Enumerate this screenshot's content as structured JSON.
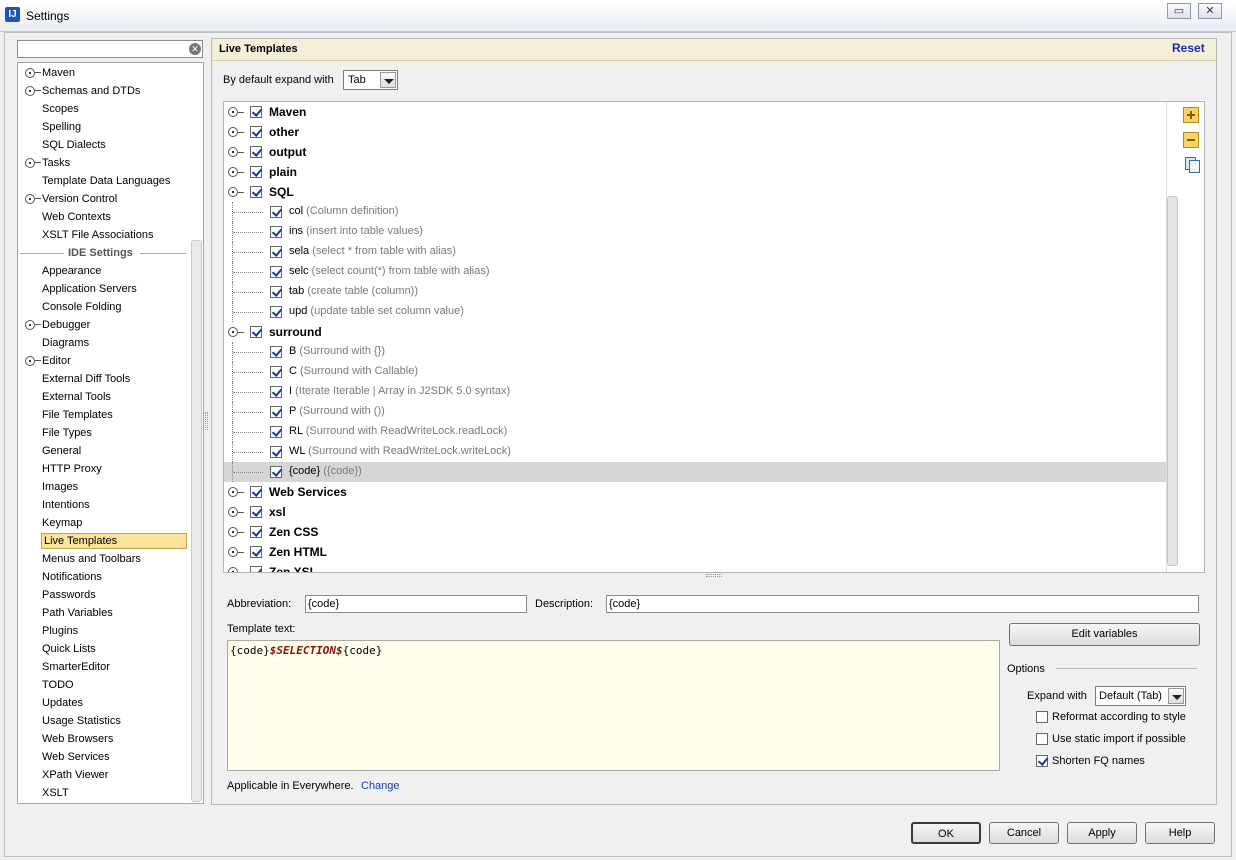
{
  "window": {
    "title": "Settings",
    "app_icon": "intellij-icon"
  },
  "search": {
    "value": ""
  },
  "sidebar": {
    "items_before": [
      {
        "label": "Maven",
        "expandable": true
      },
      {
        "label": "Schemas and DTDs",
        "expandable": true
      },
      {
        "label": "Scopes",
        "expandable": false
      },
      {
        "label": "Spelling",
        "expandable": false
      },
      {
        "label": "SQL Dialects",
        "expandable": false
      },
      {
        "label": "Tasks",
        "expandable": true
      },
      {
        "label": "Template Data Languages",
        "expandable": false
      },
      {
        "label": "Version Control",
        "expandable": true
      },
      {
        "label": "Web Contexts",
        "expandable": false
      },
      {
        "label": "XSLT File Associations",
        "expandable": false
      }
    ],
    "ide_header": "IDE Settings",
    "items_after": [
      {
        "label": "Appearance",
        "expandable": false
      },
      {
        "label": "Application Servers",
        "expandable": false
      },
      {
        "label": "Console Folding",
        "expandable": false
      },
      {
        "label": "Debugger",
        "expandable": true
      },
      {
        "label": "Diagrams",
        "expandable": false
      },
      {
        "label": "Editor",
        "expandable": true
      },
      {
        "label": "External Diff Tools",
        "expandable": false
      },
      {
        "label": "External Tools",
        "expandable": false
      },
      {
        "label": "File Templates",
        "expandable": false
      },
      {
        "label": "File Types",
        "expandable": false
      },
      {
        "label": "General",
        "expandable": false
      },
      {
        "label": "HTTP Proxy",
        "expandable": false
      },
      {
        "label": "Images",
        "expandable": false
      },
      {
        "label": "Intentions",
        "expandable": false
      },
      {
        "label": "Keymap",
        "expandable": false
      },
      {
        "label": "Live Templates",
        "expandable": false,
        "selected": true
      },
      {
        "label": "Menus and Toolbars",
        "expandable": false
      },
      {
        "label": "Notifications",
        "expandable": false
      },
      {
        "label": "Passwords",
        "expandable": false
      },
      {
        "label": "Path Variables",
        "expandable": false
      },
      {
        "label": "Plugins",
        "expandable": false
      },
      {
        "label": "Quick Lists",
        "expandable": false
      },
      {
        "label": "SmarterEditor",
        "expandable": false
      },
      {
        "label": "TODO",
        "expandable": false
      },
      {
        "label": "Updates",
        "expandable": false
      },
      {
        "label": "Usage Statistics",
        "expandable": false
      },
      {
        "label": "Web Browsers",
        "expandable": false
      },
      {
        "label": "Web Services",
        "expandable": false
      },
      {
        "label": "XPath Viewer",
        "expandable": false
      },
      {
        "label": "XSLT",
        "expandable": false
      }
    ]
  },
  "panel": {
    "title": "Live Templates",
    "reset_label": "Reset",
    "default_expand_label": "By default expand with",
    "default_expand_value": "Tab"
  },
  "tree": [
    {
      "kind": "group",
      "name": "Maven",
      "checked": true,
      "expanded": false
    },
    {
      "kind": "group",
      "name": "other",
      "checked": true,
      "expanded": false
    },
    {
      "kind": "group",
      "name": "output",
      "checked": true,
      "expanded": false
    },
    {
      "kind": "group",
      "name": "plain",
      "checked": true,
      "expanded": false
    },
    {
      "kind": "group",
      "name": "SQL",
      "checked": true,
      "expanded": true
    },
    {
      "kind": "item",
      "name": "col",
      "desc": "(Column definition)",
      "checked": true
    },
    {
      "kind": "item",
      "name": "ins",
      "desc": "(insert into table values)",
      "checked": true
    },
    {
      "kind": "item",
      "name": "sela",
      "desc": "(select * from table with alias)",
      "checked": true
    },
    {
      "kind": "item",
      "name": "selc",
      "desc": "(select count(*) from table with alias)",
      "checked": true
    },
    {
      "kind": "item",
      "name": "tab",
      "desc": "(create table (column))",
      "checked": true
    },
    {
      "kind": "item",
      "name": "upd",
      "desc": "(update table set column value)",
      "checked": true
    },
    {
      "kind": "group",
      "name": "surround",
      "checked": true,
      "expanded": true
    },
    {
      "kind": "item",
      "name": "B",
      "desc": "(Surround with {})",
      "checked": true
    },
    {
      "kind": "item",
      "name": "C",
      "desc": "(Surround with Callable)",
      "checked": true
    },
    {
      "kind": "item",
      "name": "I",
      "desc": "(Iterate Iterable | Array in J2SDK 5.0 syntax)",
      "checked": true
    },
    {
      "kind": "item",
      "name": "P",
      "desc": "(Surround with ())",
      "checked": true
    },
    {
      "kind": "item",
      "name": "RL",
      "desc": "(Surround with ReadWriteLock.readLock)",
      "checked": true
    },
    {
      "kind": "item",
      "name": "WL",
      "desc": "(Surround with ReadWriteLock.writeLock)",
      "checked": true
    },
    {
      "kind": "item",
      "name": "{code}",
      "desc": "({code})",
      "checked": true,
      "selected": true
    },
    {
      "kind": "group",
      "name": "Web Services",
      "checked": true,
      "expanded": false
    },
    {
      "kind": "group",
      "name": "xsl",
      "checked": true,
      "expanded": false
    },
    {
      "kind": "group",
      "name": "Zen CSS",
      "checked": true,
      "expanded": false
    },
    {
      "kind": "group",
      "name": "Zen HTML",
      "checked": true,
      "expanded": false
    },
    {
      "kind": "group",
      "name": "Zen XSL",
      "checked": true,
      "expanded": false
    }
  ],
  "side_buttons": {
    "add": "add-icon",
    "remove": "remove-icon",
    "copy": "copy-icon"
  },
  "editor": {
    "abbreviation_label": "Abbreviation:",
    "abbreviation_value": "{code}",
    "description_label": "Description:",
    "description_value": "{code}",
    "template_text_label": "Template text:",
    "template_text_before": "{code}",
    "template_text_var": "$SELECTION$",
    "template_text_after": "{code}",
    "edit_variables_label": "Edit variables",
    "options_label": "Options",
    "expand_with_label": "Expand with",
    "expand_with_value": "Default (Tab)",
    "reformat_label": "Reformat according to style",
    "reformat_checked": false,
    "static_import_label": "Use static import if possible",
    "static_import_checked": false,
    "shorten_fq_label": "Shorten FQ names",
    "shorten_fq_checked": true,
    "applicable_label": "Applicable in Everywhere.",
    "change_label": "Change"
  },
  "footer": {
    "ok": "OK",
    "cancel": "Cancel",
    "apply": "Apply",
    "help": "Help"
  }
}
